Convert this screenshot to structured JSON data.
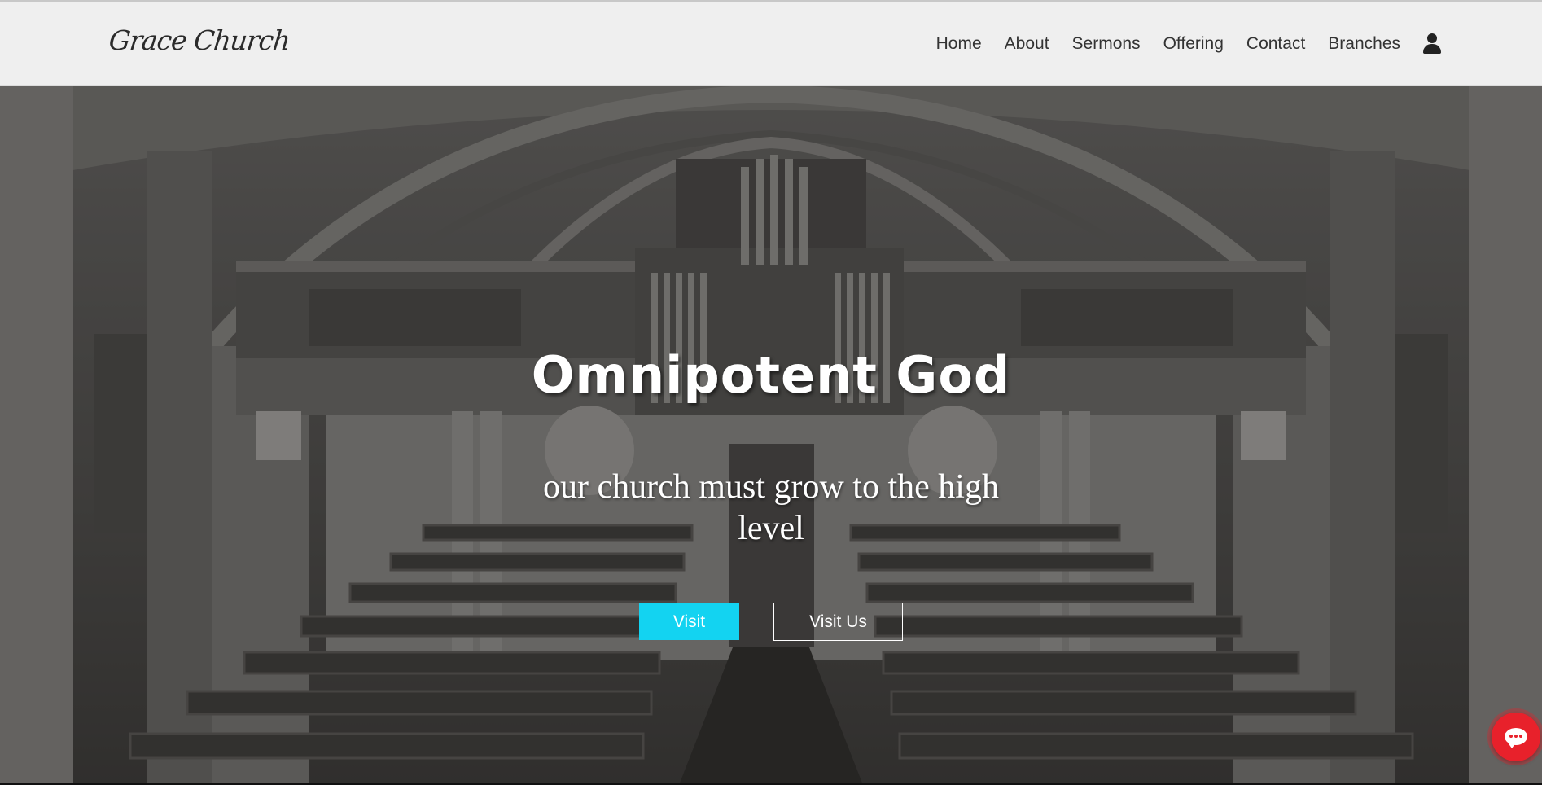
{
  "brand": {
    "name": "Grace Church"
  },
  "nav": {
    "items": [
      "Home",
      "About",
      "Sermons",
      "Offering",
      "Contact",
      "Branches"
    ],
    "user_icon": "user-icon"
  },
  "hero": {
    "title": "Omnipotent God",
    "subtitle": "our church must grow to the high level",
    "primary_button": "Visit",
    "secondary_button": "Visit Us",
    "background": "church interior with pipe organ, grayscale"
  },
  "chat": {
    "icon": "chat-icon"
  },
  "colors": {
    "navbar_bg": "#efefef",
    "primary_button": "#13d3f1",
    "chat_button": "#e8212b",
    "text_light": "#ffffff"
  }
}
